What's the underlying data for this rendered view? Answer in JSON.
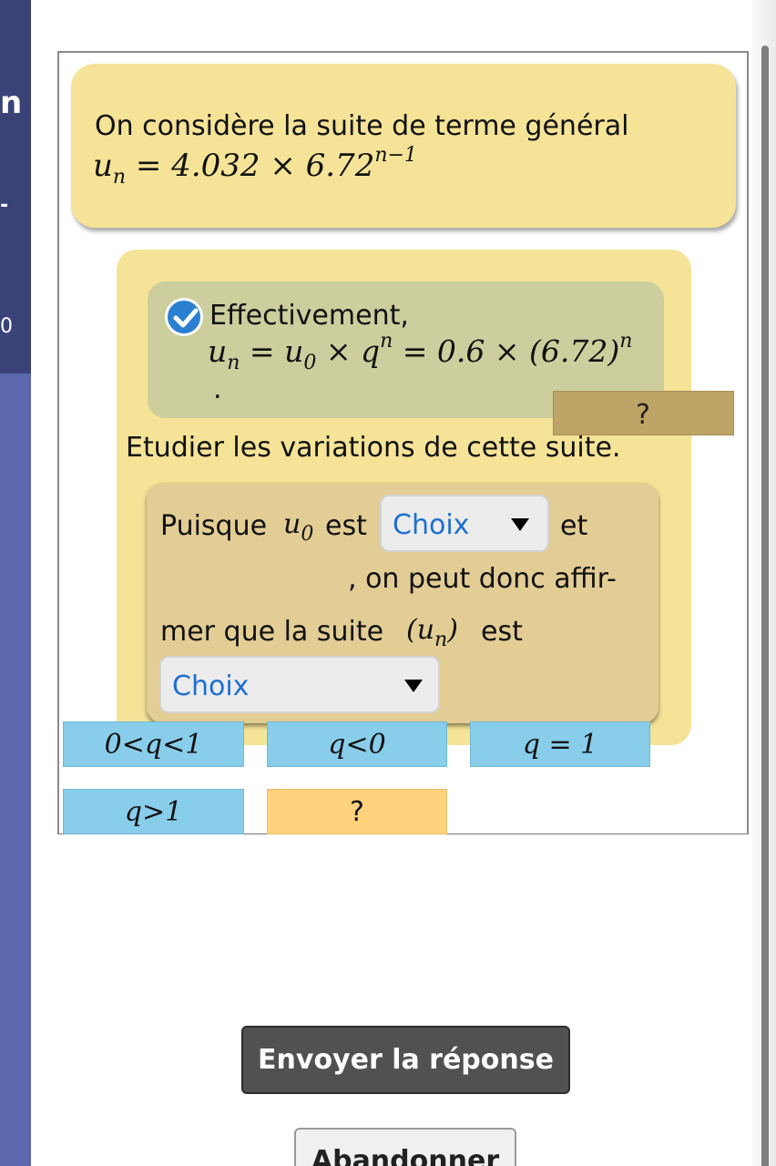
{
  "sidebar": {
    "fragment_1": "n",
    "fragment_2": "-",
    "fragment_3": "0"
  },
  "statement": {
    "text": "On considère la suite de terme général",
    "formula": {
      "lhs": "u",
      "lhs_sub": "n",
      "rhs": " = 4.032 × 6.72",
      "exponent": "n−1"
    }
  },
  "feedback": {
    "icon": "check-icon",
    "title": "Effectivement,",
    "formula": {
      "a": "u",
      "a_sub": "n",
      "b": " = u",
      "b_sub": "0",
      "c": " × q",
      "c_sup": "n",
      "d": " = 0.6 × (6.72)",
      "d_sup": "n"
    },
    "dot": "."
  },
  "help_bar_label": "?",
  "question": "Etudier les variations de cette suite.",
  "answer": {
    "part1": "Puisque",
    "u": "u",
    "u_sub": "0",
    "part2": "est",
    "select1_value": "Choix",
    "part3": "et",
    "part4": ", on peut donc affir-",
    "part5": "mer que la suite",
    "seq_open": "(u",
    "seq_sub": "n",
    "seq_close": ")",
    "part6": "est",
    "select2_value": "Choix"
  },
  "choices": [
    "0<q<1",
    "q<0",
    "q = 1",
    "q>1"
  ],
  "choices_help": "?",
  "buttons": {
    "send": "Envoyer la réponse",
    "abandon": "Abandonner"
  },
  "colors": {
    "statement_bg": "#f5e397",
    "feedback_bg": "#ccce9d",
    "answer_bg": "#e2cd95",
    "choice_bg": "#88cdea",
    "help_bg": "#ffd27d",
    "link_blue": "#1d6fd0"
  }
}
